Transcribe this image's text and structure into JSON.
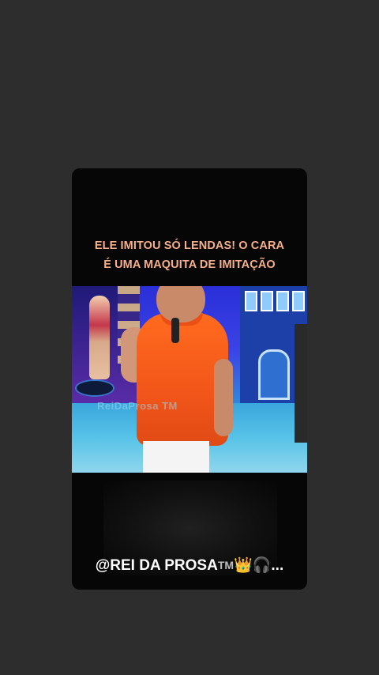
{
  "story": {
    "caption_line1": "ELE IMITOU SÓ LENDAS! O CARA",
    "caption_line2": "É UMA MAQUITA DE IMITAÇÃO",
    "video_watermark": "ReiDaProsa TM",
    "handle_text": "@REI DA PROSA",
    "handle_tm": "TM",
    "handle_crown": "👑",
    "handle_headphones": "🎧",
    "handle_ellipsis": "..."
  },
  "colors": {
    "background": "#2d2d2d",
    "card": "#060606",
    "caption": "#f6b08a",
    "shirt": "#f2561a"
  },
  "icons": [
    "crown-icon",
    "headphones-icon"
  ]
}
